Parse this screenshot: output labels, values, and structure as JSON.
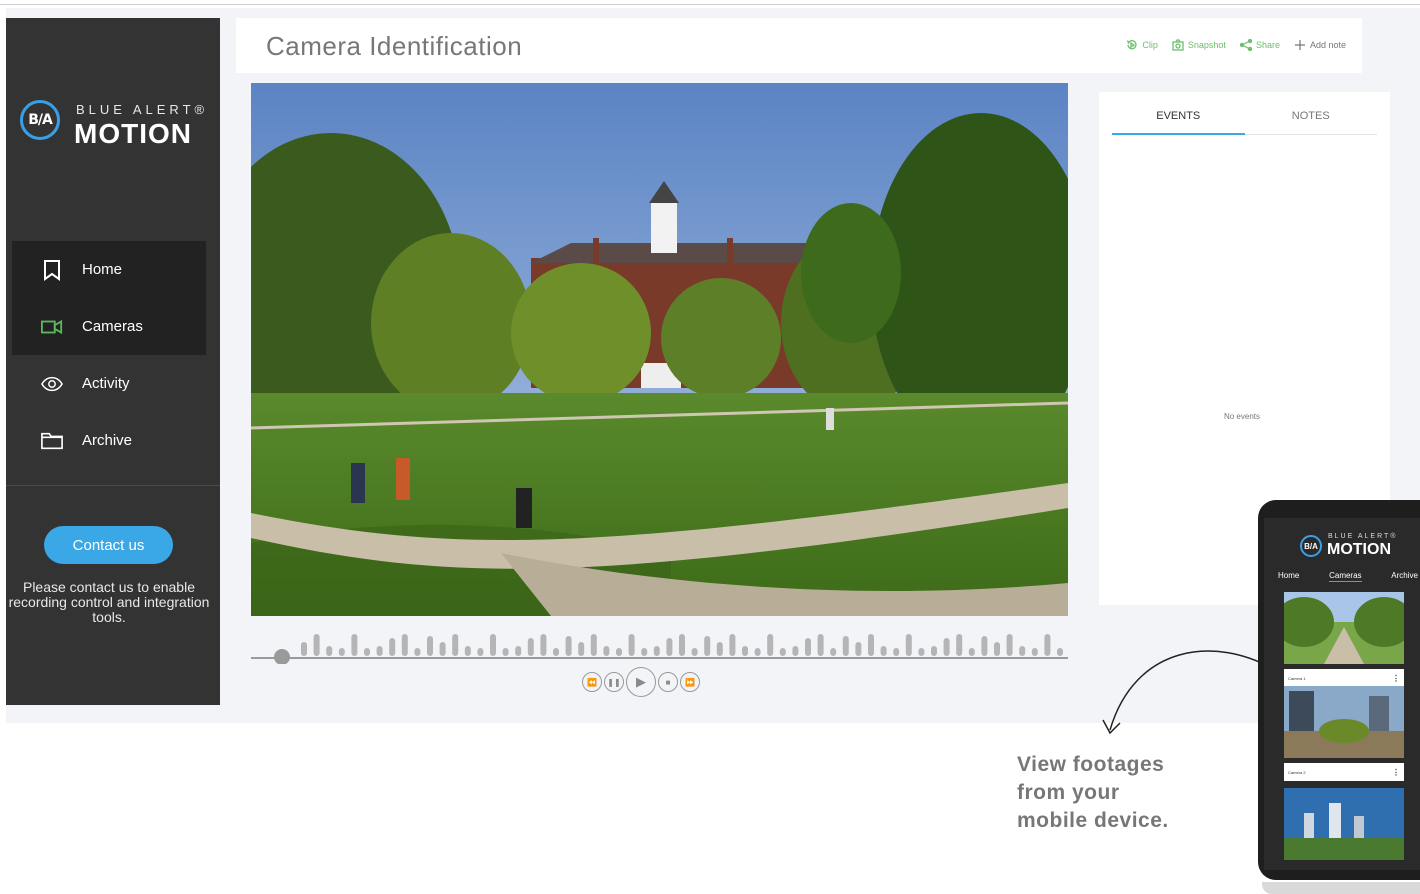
{
  "brand": {
    "top": "BLUE ALERT®",
    "bottom": "MOTION",
    "mark": "B/A"
  },
  "sidebar": {
    "items": [
      {
        "label": "Home",
        "icon": "bookmark-icon"
      },
      {
        "label": "Cameras",
        "icon": "video-camera-icon"
      },
      {
        "label": "Activity",
        "icon": "eye-icon"
      },
      {
        "label": "Archive",
        "icon": "folder-icon"
      }
    ],
    "contact_button": "Contact us",
    "contact_text": "Please contact us to enable recording control and integration tools."
  },
  "header": {
    "title": "Camera Identification",
    "actions": [
      {
        "label": "Clip",
        "icon": "clip-icon"
      },
      {
        "label": "Snapshot",
        "icon": "camera-icon"
      },
      {
        "label": "Share",
        "icon": "share-icon"
      },
      {
        "label": "Add note",
        "icon": "plus-icon"
      }
    ]
  },
  "panel": {
    "tabs": [
      "EVENTS",
      "NOTES"
    ],
    "empty_text": "No events"
  },
  "promo": {
    "line1": "View footages",
    "line2": "from your",
    "line3": "mobile device."
  },
  "phone": {
    "brand_top": "BLUE ALERT®",
    "brand_bottom": "MOTION",
    "nav": [
      "Home",
      "Cameras",
      "Archive"
    ],
    "cards": [
      "Camera 1",
      "Camera 2"
    ]
  },
  "colors": {
    "accent": "#3aa7e6",
    "green": "#5cb85c",
    "sidebar": "#333333"
  }
}
